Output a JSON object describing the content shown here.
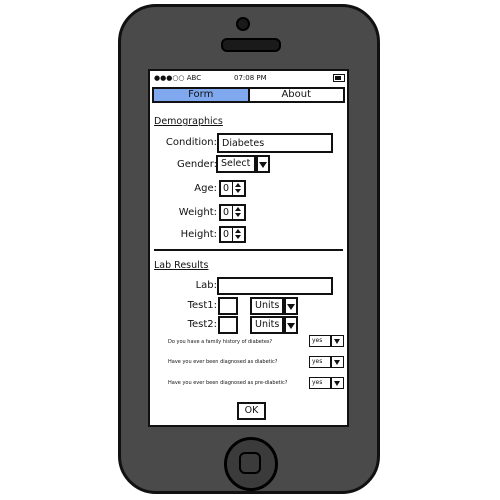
{
  "status": {
    "carrier": "●●●○○ ABC",
    "time": "07:08 PM"
  },
  "tabs": [
    {
      "label": "Form",
      "active": true
    },
    {
      "label": "About",
      "active": false
    }
  ],
  "demographics": {
    "title": "Demographics",
    "condition_label": "Condition:",
    "condition_value": "Diabetes",
    "gender_label": "Gender:",
    "gender_value": "Select",
    "age_label": "Age:",
    "age_value": "0",
    "weight_label": "Weight:",
    "weight_value": "0",
    "height_label": "Height:",
    "height_value": "0"
  },
  "lab": {
    "title": "Lab Results",
    "lab_label": "Lab:",
    "lab_value": "",
    "test1_label": "Test1:",
    "test1_value": "",
    "test1_units": "Units",
    "test2_label": "Test2:",
    "test2_value": "",
    "test2_units": "Units"
  },
  "questions": [
    {
      "text": "Do you have a family history of diabetes?",
      "answer": "yes"
    },
    {
      "text": "Have you ever been diagnosed as diabetic?",
      "answer": "yes"
    },
    {
      "text": "Have you ever been diagnosed as pre-diabetic?",
      "answer": "yes"
    }
  ],
  "ok_label": "OK",
  "colors": {
    "active_tab": "#7fa8ee",
    "phone_body": "#4a4a4a"
  }
}
